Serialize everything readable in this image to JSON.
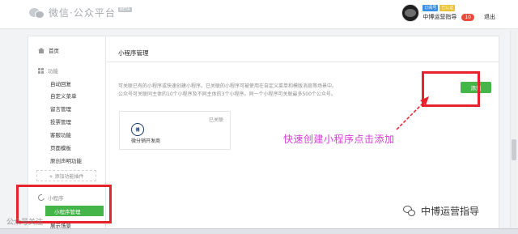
{
  "header": {
    "app_title": "微信·公众平台",
    "beta_label": "BETA",
    "badges": [
      "订阅号",
      "已认证"
    ],
    "username": "中博运营指导",
    "notification_count": "10",
    "logout_label": "退出"
  },
  "sidebar": {
    "home_label": "首页",
    "feature_group": "功能",
    "feature_items": [
      "自动回复",
      "自定义菜单",
      "留言管理",
      "投票管理",
      "客服功能",
      "页面模板",
      "原创声明功能"
    ],
    "add_plugin_label": "+ 添加功能插件",
    "mp_group": "小程序",
    "mp_active_item": "小程序管理",
    "mp_next_item": "展示场景"
  },
  "content": {
    "title": "小程序管理",
    "description_line1": "可关联已有的小程序或快速创建小程序。已关联的小程序可被使用在自定义菜单和模版消息等场景中。",
    "description_line2": "公众号可关联同主体的10个小程序及不同主体的3个小程序。同一个小程序可关联最多500个公众号。",
    "add_button_label": "添加",
    "card": {
      "logo_text": "博",
      "name": "微分销开发商",
      "status": "已关联"
    }
  },
  "annotation": {
    "text": "快速创建小程序点击添加"
  },
  "watermark": {
    "text": "中博运营指导"
  },
  "overlay_text": "公众号关注"
}
